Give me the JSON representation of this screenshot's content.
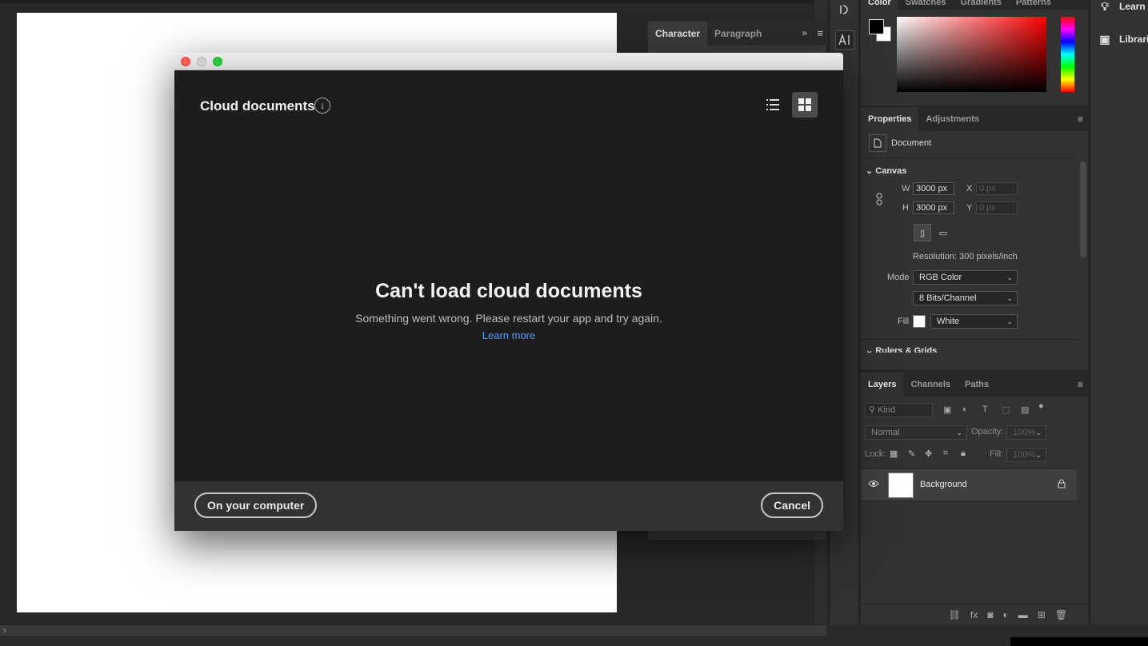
{
  "character_panel": {
    "tabs": [
      "Character",
      "Paragraph"
    ],
    "active_tab": "Character"
  },
  "color_panel": {
    "tabs": [
      "Color",
      "Swatches",
      "Gradients",
      "Patterns"
    ],
    "foreground": "#000000",
    "background": "#ffffff"
  },
  "properties": {
    "tabs": [
      "Properties",
      "Adjustments"
    ],
    "document_label": "Document",
    "canvas_section": "Canvas",
    "width_label": "W",
    "width": "3000 px",
    "height_label": "H",
    "height": "3000 px",
    "x_label": "X",
    "x_placeholder": "0 px",
    "y_label": "Y",
    "y_placeholder": "0 px",
    "resolution": "Resolution: 300 pixels/inch",
    "mode_label": "Mode",
    "mode_value": "RGB Color",
    "bits_value": "8 Bits/Channel",
    "fill_label": "Fill",
    "fill_value": "White",
    "next_section": "Rulers & Grids"
  },
  "layers": {
    "tabs": [
      "Layers",
      "Channels",
      "Paths"
    ],
    "filter_placeholder": "Kind",
    "blend_mode": "Normal",
    "opacity_label": "Opacity:",
    "opacity_value": "100%",
    "lock_label": "Lock:",
    "fill_label": "Fill:",
    "fill_value": "100%",
    "items": [
      {
        "name": "Background"
      }
    ]
  },
  "far_right": {
    "items": [
      {
        "label": "Learn"
      },
      {
        "label": "Libraries"
      }
    ]
  },
  "dialog": {
    "title": "Cloud documents",
    "error_heading": "Can't load cloud documents",
    "error_message": "Something went wrong. Please restart your app and try again.",
    "learn_more": "Learn more",
    "on_computer_button": "On your computer",
    "cancel_button": "Cancel",
    "traffic_lights": {
      "close": "#ff5f57",
      "minimize": "#c8c8c8",
      "zoom": "#28c840"
    },
    "link_color": "#4e9cff"
  }
}
